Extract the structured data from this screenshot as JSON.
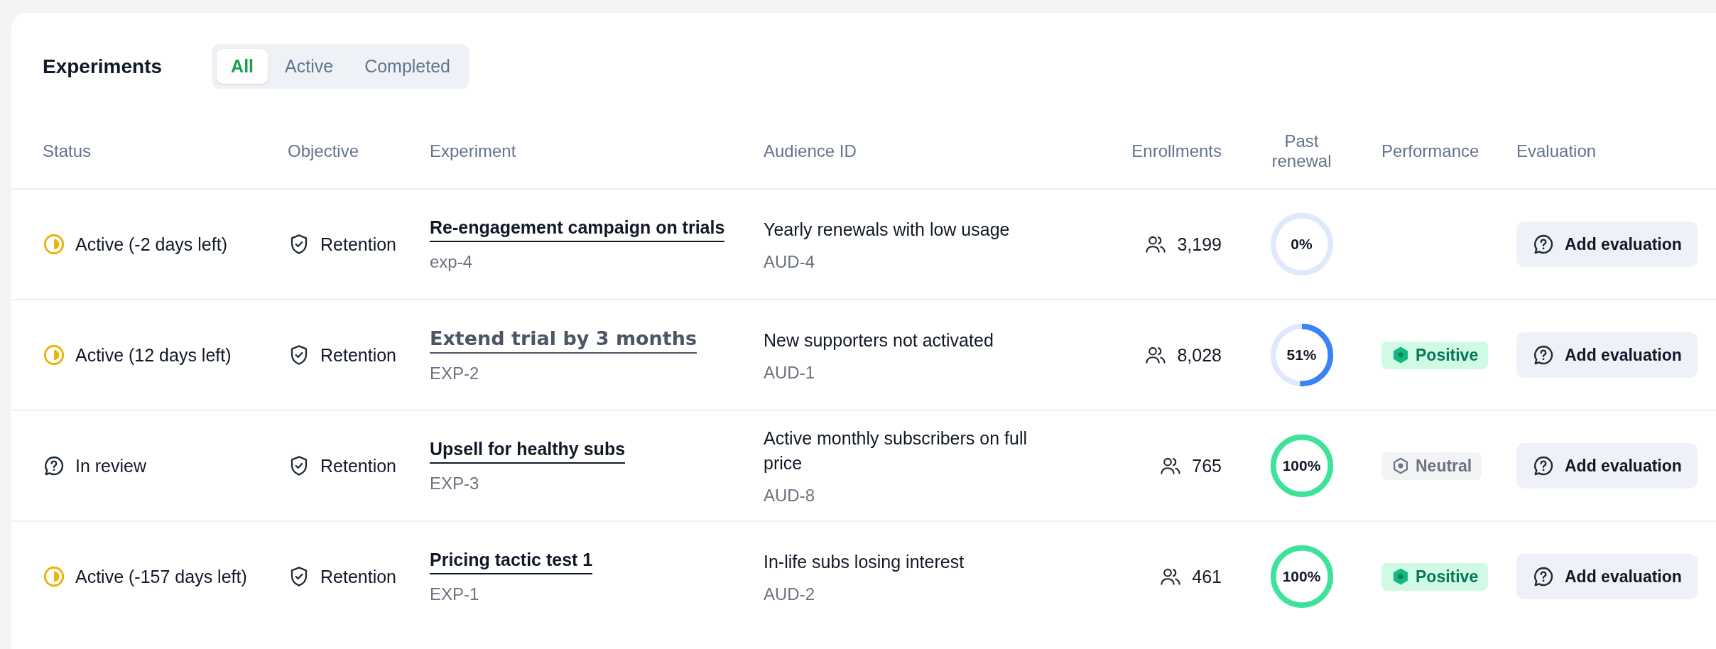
{
  "title": "Experiments",
  "tabs": [
    {
      "label": "All",
      "selected": true
    },
    {
      "label": "Active",
      "selected": false
    },
    {
      "label": "Completed",
      "selected": false
    }
  ],
  "table": {
    "columns": [
      "Status",
      "Objective",
      "Experiment",
      "Audience ID",
      "Enrollments",
      "Past renewal",
      "Performance",
      "Evaluation"
    ],
    "rows": [
      {
        "status": {
          "kind": "active",
          "label": "Active (-2 days left)"
        },
        "objective": "Retention",
        "experiment": {
          "name": "Re-engagement campaign on trials",
          "id": "exp-4",
          "hovered": false
        },
        "audience": {
          "name": "Yearly renewals with low usage",
          "id": "AUD-4"
        },
        "enrollments": "3,199",
        "past_renewal": {
          "level": 0,
          "reading": "0%"
        },
        "evaluation": "Add evaluation"
      },
      {
        "status": {
          "kind": "active",
          "label": "Active (12 days left)"
        },
        "objective": "Retention",
        "experiment": {
          "name": "Extend trial by 3 months",
          "id": "EXP-2",
          "hovered": true
        },
        "audience": {
          "name": "New supporters not activated",
          "id": "AUD-1"
        },
        "enrollments": "8,028",
        "past_renewal": {
          "level": 0.51,
          "reading": "51%"
        },
        "performance": {
          "kind": "positive",
          "label": "Positive"
        },
        "evaluation": "Add evaluation"
      },
      {
        "status": {
          "kind": "review",
          "label": "In review"
        },
        "objective": "Retention",
        "experiment": {
          "name": "Upsell for healthy subs",
          "id": "EXP-3",
          "hovered": false
        },
        "audience": {
          "name": "Active monthly subscribers on full price",
          "id": "AUD-8"
        },
        "enrollments": "765",
        "past_renewal": {
          "level": 1,
          "reading": "100%"
        },
        "performance": {
          "kind": "neutral",
          "label": "Neutral"
        },
        "evaluation": "Add evaluation"
      },
      {
        "status": {
          "kind": "active",
          "label": "Active (-157 days left)"
        },
        "objective": "Retention",
        "experiment": {
          "name": "Pricing tactic test 1",
          "id": "EXP-1",
          "hovered": false
        },
        "audience": {
          "name": "In-life subs losing interest",
          "id": "AUD-2"
        },
        "enrollments": "461",
        "past_renewal": {
          "level": 1,
          "reading": "100%"
        },
        "performance": {
          "kind": "positive",
          "label": "Positive"
        },
        "evaluation": "Add evaluation"
      }
    ]
  }
}
